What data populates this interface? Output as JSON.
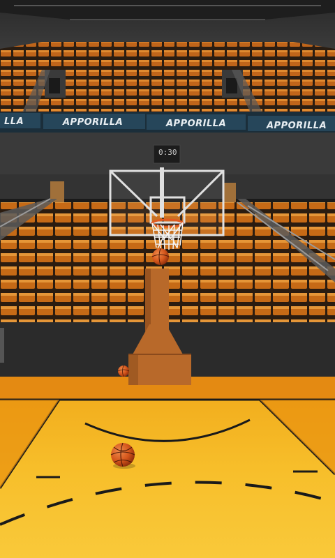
{
  "arena": {
    "sponsor_banner_text": "APPORILLA",
    "sponsor_banner_left_fragment": "LLA"
  },
  "scoreboard": {
    "time": "0:30"
  },
  "colors": {
    "seat_orange": "#c96a14",
    "court_yellow": "#f2b41c",
    "court_orange": "#e48a12",
    "banner_blue": "#26465a",
    "ball_orange": "#d4561c"
  },
  "icons": {
    "ball": "basketball-icon"
  }
}
